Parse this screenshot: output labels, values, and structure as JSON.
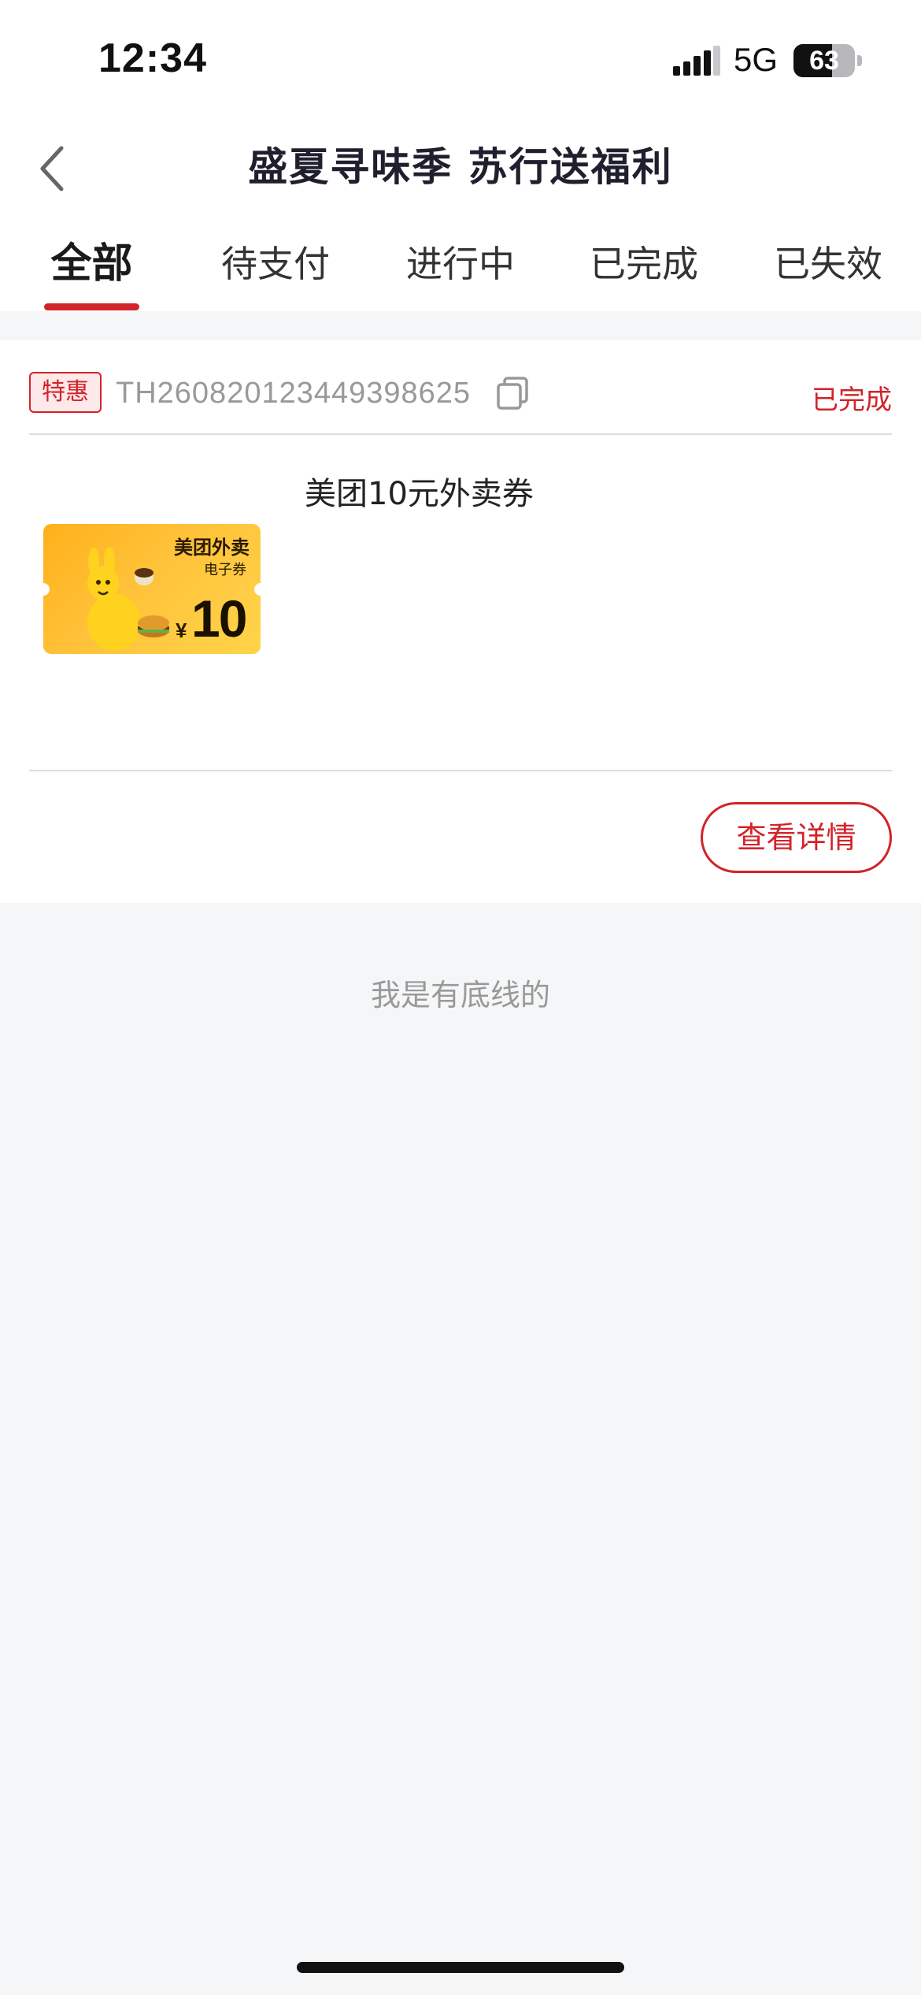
{
  "status_bar": {
    "time": "12:34",
    "network": "5G",
    "battery": "63",
    "battery_level": 0.63
  },
  "nav": {
    "title": "盛夏寻味季 苏行送福利",
    "back_icon": "chevron-left-icon"
  },
  "tabs": [
    {
      "label": "全部",
      "active": true
    },
    {
      "label": "待支付",
      "active": false
    },
    {
      "label": "进行中",
      "active": false
    },
    {
      "label": "已完成",
      "active": false
    },
    {
      "label": "已失效",
      "active": false
    }
  ],
  "order": {
    "badge": "特惠",
    "order_no": "TH260820123449398625",
    "status": "已完成",
    "product": {
      "name": "美团10元外卖券",
      "coupon": {
        "brand": "美团外卖",
        "sub": "电子券",
        "currency": "¥",
        "amount": "10"
      }
    },
    "detail_button": "查看详情"
  },
  "footer_note": "我是有底线的",
  "colors": {
    "accent": "#d2232a",
    "background": "#f5f6f8",
    "card": "#ffffff"
  }
}
